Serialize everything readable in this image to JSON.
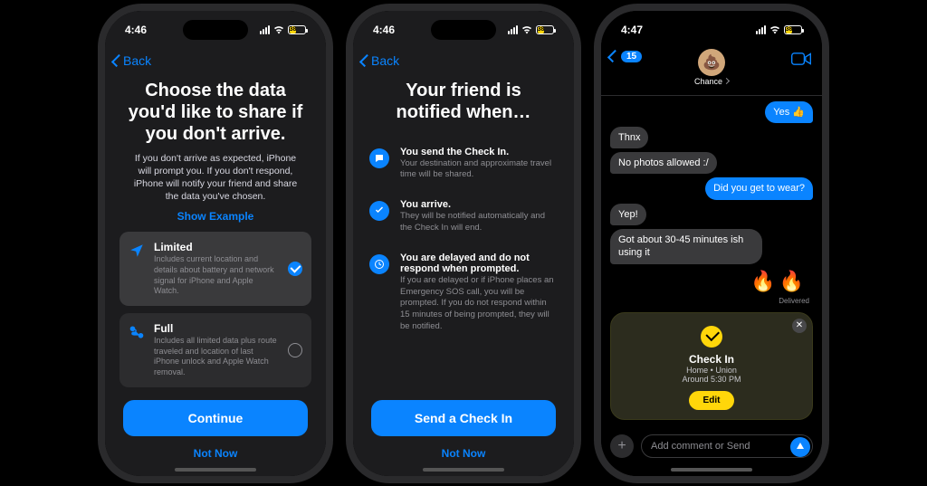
{
  "colors": {
    "accent": "#0a84ff",
    "yellow": "#ffd60a"
  },
  "status": {
    "time1": "4:46",
    "time2": "4:47",
    "battery_pct": "38"
  },
  "nav": {
    "back": "Back"
  },
  "screen1": {
    "title": "Choose the data you'd like to share if you don't arrive.",
    "subtitle": "If you don't arrive as expected, iPhone will prompt you. If you don't respond, iPhone will notify your friend and share the data you've chosen.",
    "show_example": "Show Example",
    "options": [
      {
        "title": "Limited",
        "desc": "Includes current location and details about battery and network signal for iPhone and Apple Watch.",
        "selected": true
      },
      {
        "title": "Full",
        "desc": "Includes all limited data plus route traveled and location of last iPhone unlock and Apple Watch removal.",
        "selected": false
      }
    ],
    "primary": "Continue",
    "secondary": "Not Now"
  },
  "screen2": {
    "title": "Your friend is notified when…",
    "rows": [
      {
        "icon": "chat-icon",
        "title": "You send the Check In.",
        "desc": "Your destination and approximate travel time will be shared."
      },
      {
        "icon": "check-icon",
        "title": "You arrive.",
        "desc": "They will be notified automatically and the Check In will end."
      },
      {
        "icon": "clock-icon",
        "title": "You are delayed and do not respond when prompted.",
        "desc": "If you are delayed or if iPhone places an Emergency SOS call, you will be prompted. If you do not respond within 15 minutes of being prompted, they will be notified."
      }
    ],
    "primary": "Send a Check In",
    "secondary": "Not Now"
  },
  "screen3": {
    "back_badge": "15",
    "contact": "Chance",
    "avatar_emoji": "💩",
    "messages": [
      {
        "dir": "out",
        "text": "Yes 👍"
      },
      {
        "dir": "in",
        "text": "Thnx"
      },
      {
        "dir": "in",
        "text": "No photos allowed :/"
      },
      {
        "dir": "out",
        "text": "Did you get to wear?"
      },
      {
        "dir": "in",
        "text": "Yep!"
      },
      {
        "dir": "in",
        "text": "Got about 30-45 minutes ish using it"
      }
    ],
    "reaction": "🔥🔥",
    "delivered": "Delivered",
    "checkin": {
      "title": "Check In",
      "line1": "Home • Union",
      "line2": "Around 5:30 PM",
      "edit": "Edit"
    },
    "compose_placeholder": "Add comment or Send"
  }
}
